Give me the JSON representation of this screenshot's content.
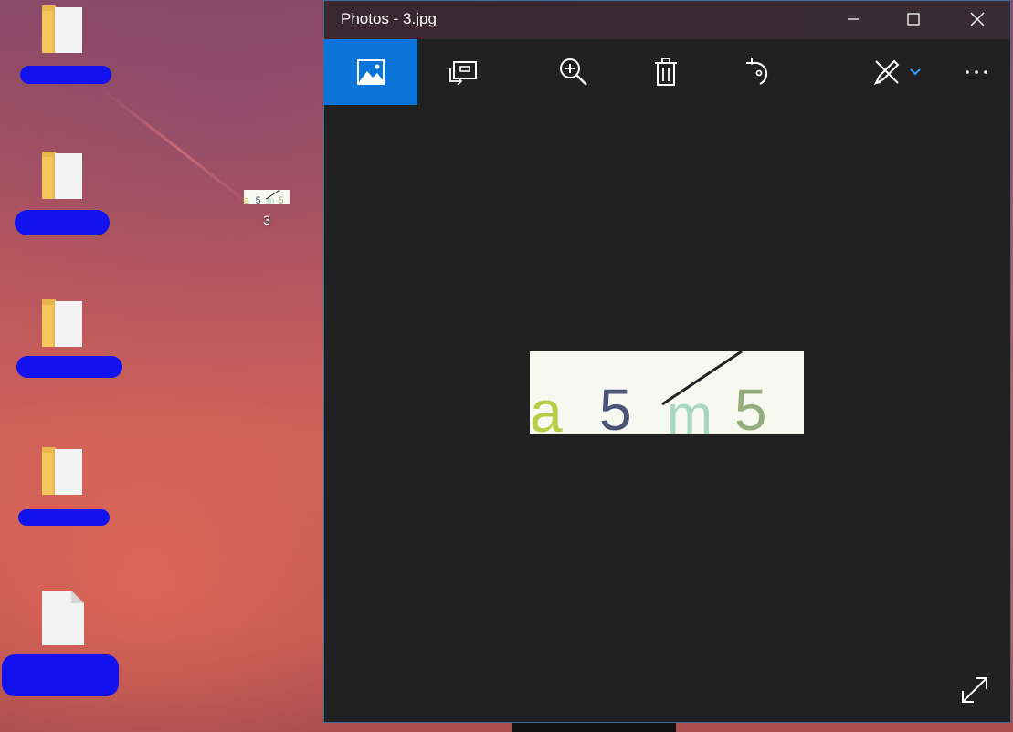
{
  "window": {
    "title": "Photos - 3.jpg"
  },
  "toolbar": {
    "items": [
      "image-view",
      "slideshow",
      "zoom",
      "delete",
      "rotate",
      "edit",
      "more"
    ]
  },
  "desktop": {
    "thumbnail_label": "3"
  },
  "photo": {
    "captcha_chars": [
      "a",
      "5",
      "m",
      "5"
    ]
  },
  "colors": {
    "accent": "#0a74d8",
    "window_bg": "#212121",
    "redaction": "#1212ee"
  }
}
